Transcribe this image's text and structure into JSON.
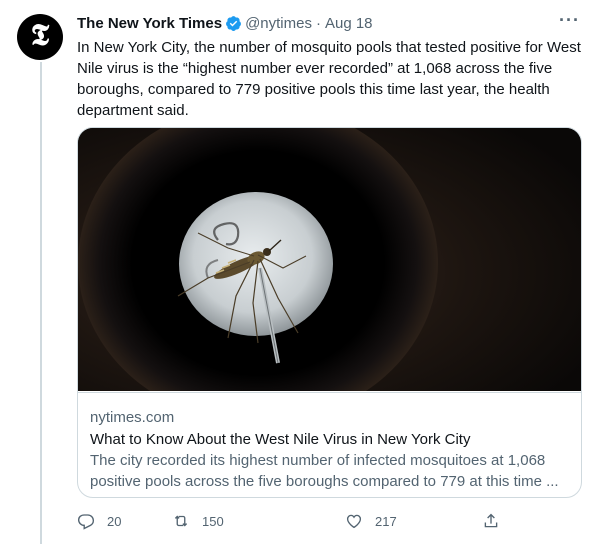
{
  "author": {
    "name": "The New York Times",
    "handle": "@nytimes",
    "separator": "·",
    "date": "Aug 18",
    "verified": true,
    "avatar_glyph": "𝕿"
  },
  "tweet": {
    "text": "In New York City, the number of mosquito pools that tested positive for West Nile virus is the “highest number ever recorded” at 1,068 across the five boroughs, compared to 779 positive pools this time last year, the health department said."
  },
  "card": {
    "domain": "nytimes.com",
    "title": "What to Know About the West Nile Virus in New York City",
    "description": "The city recorded its highest number of infected mosquitoes at 1,068 positive pools across the five boroughs compared to 779 at this time ..."
  },
  "actions": {
    "reply_count": "20",
    "retweet_count": "150",
    "like_count": "217"
  },
  "icons": {
    "more": "more-horizontal-icon",
    "verified": "verified-badge-icon",
    "reply": "reply-icon",
    "retweet": "retweet-icon",
    "like": "heart-icon",
    "share": "share-icon"
  },
  "colors": {
    "verified_blue": "#1d9bf0",
    "secondary_text": "#536471",
    "primary_text": "#0f1419",
    "border": "#cfd9de"
  }
}
